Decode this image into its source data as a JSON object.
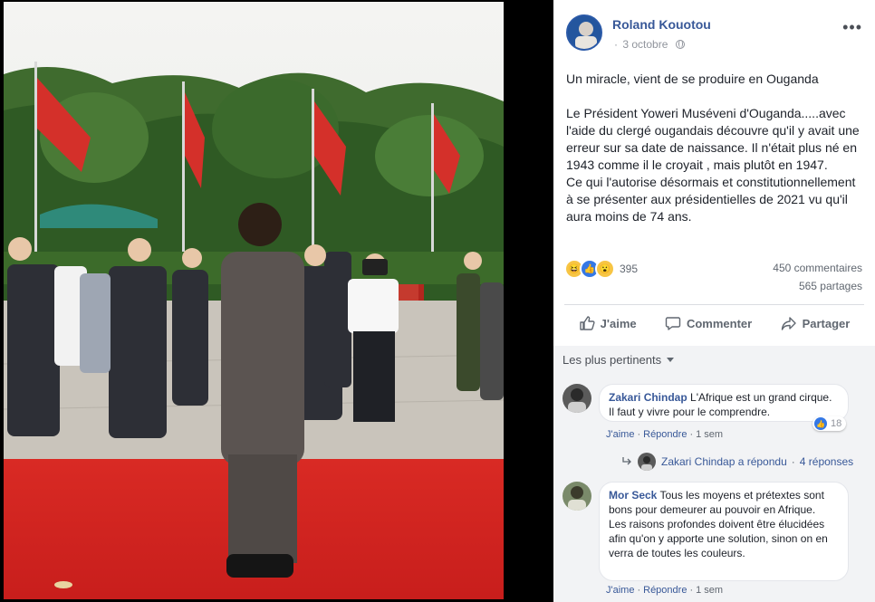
{
  "post": {
    "author": "Roland Kouotou",
    "date": "3 octobre",
    "headline": "Un miracle, vient de se produire en Ouganda",
    "body": "Le Président Yoweri Muséveni d'Ouganda.....avec l'aide du clergé ougandais découvre qu'il y avait une erreur sur sa date de naissance. Il n'était plus né en 1943 comme il le croyait , mais plutôt en 1947.\nCe qui l'autorise désormais et constitutionnellement à se présenter aux présidentielles de 2021 vu qu'il aura moins de 74 ans.",
    "reactions_count": "395",
    "comments_count": "450 commentaires",
    "shares_count": "565 partages",
    "reaction_icons": [
      "haha-icon",
      "like-icon",
      "wow-icon"
    ]
  },
  "actions": {
    "like": "J'aime",
    "comment": "Commenter",
    "share": "Partager"
  },
  "sort_label": "Les plus pertinents",
  "comments": [
    {
      "author": "Zakari Chindap",
      "text": "L'Afrique est un grand cirque. Il faut y vivre pour le comprendre.",
      "like_count": "18",
      "like_label": "J'aime",
      "reply_label": "Répondre",
      "time": "1 sem",
      "replies_summary": "Zakari Chindap a répondu",
      "replies_count": "4 réponses"
    },
    {
      "author": "Mor Seck",
      "text": "Tous les moyens et prétextes sont bons pour demeurer au pouvoir en Afrique.\nLes raisons profondes doivent être élucidées afin qu'on y apporte une solution, sinon on en verra de toutes les couleurs.",
      "like_label": "J'aime",
      "reply_label": "Répondre",
      "time": "1 sem"
    }
  ],
  "colors": {
    "link": "#385898",
    "secondary": "#606770",
    "comments_bg": "#f2f3f5",
    "like_blue": "#3578e5",
    "carpet_red": "#d42424"
  }
}
